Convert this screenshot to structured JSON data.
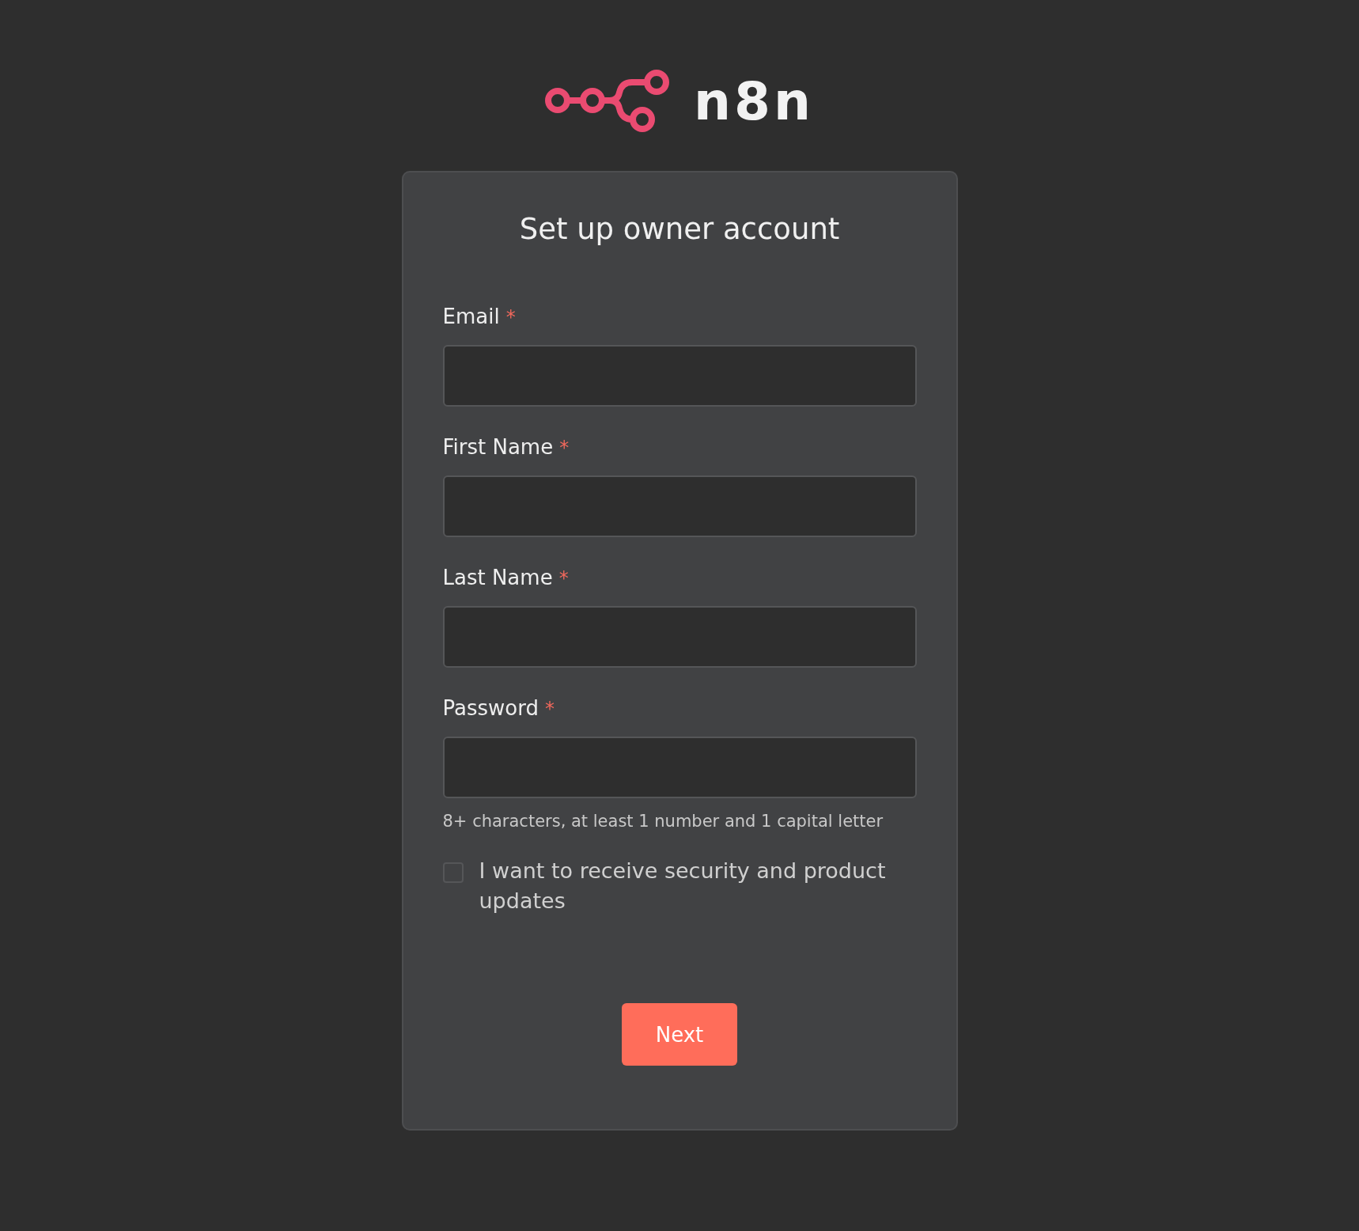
{
  "logo": {
    "text": "n8n"
  },
  "title": "Set up owner account",
  "fields": [
    {
      "label": "Email",
      "required": true
    },
    {
      "label": "First Name",
      "required": true
    },
    {
      "label": "Last Name",
      "required": true
    },
    {
      "label": "Password",
      "required": true,
      "hint": "8+ characters, at least 1 number and 1 capital letter"
    }
  ],
  "required_mark": "*",
  "consent": {
    "label": "I want to receive security and product updates",
    "checked": false
  },
  "button": "Next"
}
